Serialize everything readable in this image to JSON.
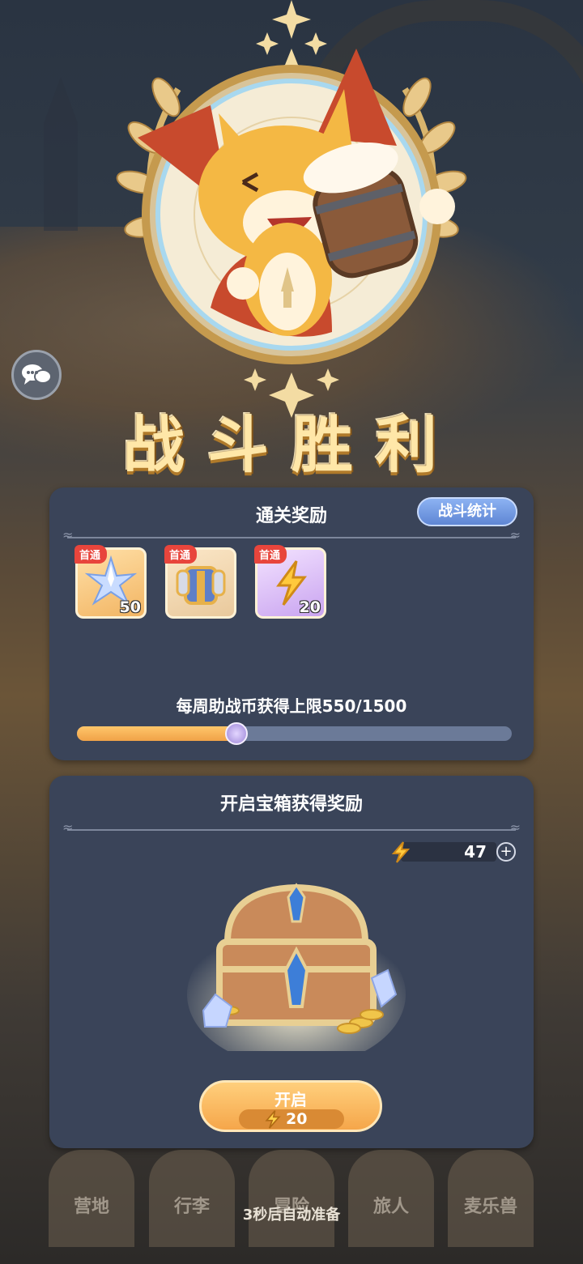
{
  "victory_title": "战斗胜利",
  "rewards_panel": {
    "title": "通关奖励",
    "stats_button": "战斗统计",
    "items": [
      {
        "badge": "首通",
        "icon": "crystal-star-icon",
        "quantity": "50",
        "frame": "orange"
      },
      {
        "badge": "首通",
        "icon": "armor-icon",
        "quantity": "",
        "frame": "orange"
      },
      {
        "badge": "首通",
        "icon": "lightning-icon",
        "quantity": "20",
        "frame": "purple"
      }
    ],
    "weekly_limit_label": "每周助战币获得上限550/1500",
    "weekly_progress": 0.367
  },
  "chest_panel": {
    "title": "开启宝箱获得奖励",
    "energy_value": "47",
    "open_button_label": "开启",
    "open_cost": "20"
  },
  "nav": {
    "items": [
      "营地",
      "行李",
      "冒险",
      "旅人",
      "麦乐兽"
    ]
  },
  "auto_ready_text": "3秒后自动准备",
  "colors": {
    "panel": "#3a4459",
    "accent_orange": "#f5a64a",
    "stats_blue": "#6f95de",
    "badge_red": "#e8453c"
  }
}
